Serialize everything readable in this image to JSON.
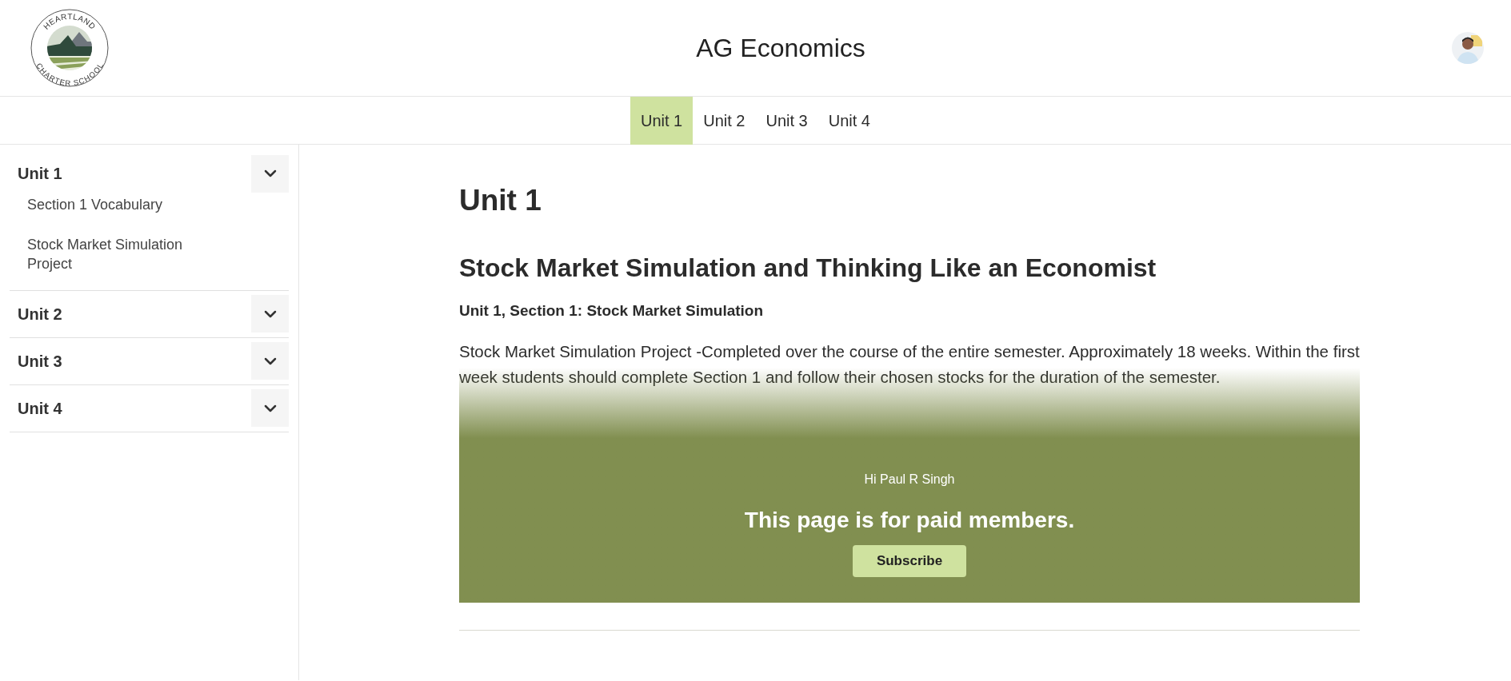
{
  "header": {
    "logo": {
      "top_text": "HEARTLAND",
      "bottom_text": "CHARTER SCHOOL"
    },
    "title": "AG Economics"
  },
  "tabs": [
    {
      "label": "Unit 1",
      "selected": true
    },
    {
      "label": "Unit 2",
      "selected": false
    },
    {
      "label": "Unit 3",
      "selected": false
    },
    {
      "label": "Unit 4",
      "selected": false
    }
  ],
  "sidebar": {
    "units": [
      {
        "label": "Unit 1",
        "children": [
          "Section 1 Vocabulary",
          "Stock Market Simulation Project"
        ]
      },
      {
        "label": "Unit 2"
      },
      {
        "label": "Unit 3"
      },
      {
        "label": "Unit 4"
      }
    ]
  },
  "content": {
    "title": "Unit 1",
    "heading": "Stock Market Simulation and Thinking Like an Economist",
    "subheading": "Unit 1, Section 1: Stock Market Simulation",
    "paragraph": "Stock Market Simulation Project -Completed over the course of the entire semester. Approximately 18 weeks. Within the first week students should complete Section 1 and follow their chosen stocks for the duration of the semester.",
    "paywall": {
      "greeting": "Hi Paul R Singh",
      "message": "This page is for paid members.",
      "button": "Subscribe"
    }
  }
}
